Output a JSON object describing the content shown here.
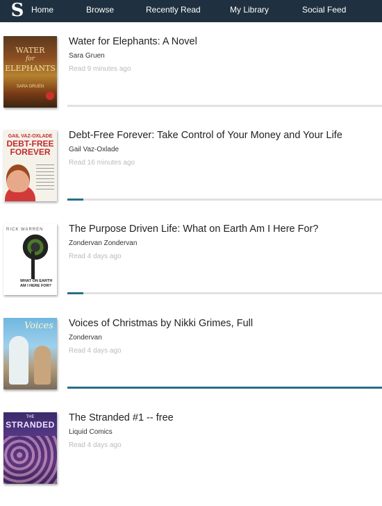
{
  "nav": {
    "logo": "S",
    "items": [
      "Home",
      "Browse",
      "Recently Read",
      "My Library",
      "Social Feed"
    ]
  },
  "books": [
    {
      "title": "Water for Elephants: A Novel",
      "author": "Sara Gruen",
      "read": "Read 9 minutes ago",
      "progress": 0,
      "cover_text": [
        "WATER",
        "for",
        "ELEPHANTS",
        "SARA GRUEN"
      ]
    },
    {
      "title": "Debt-Free Forever: Take Control of Your Money and Your Life",
      "author": "Gail Vaz-Oxlade",
      "read": "Read 16 minutes ago",
      "progress": 0.05,
      "cover_text": [
        "GAIL VAZ-OXLADE",
        "DEBT-FREE",
        "FOREVER"
      ]
    },
    {
      "title": "The Purpose Driven Life: What on Earth Am I Here For?",
      "author": "Zondervan Zondervan",
      "read": "Read 4 days ago",
      "progress": 0.05,
      "cover_text": [
        "RICK WARREN",
        "WHAT ON EARTH",
        "AM I HERE FOR?"
      ]
    },
    {
      "title": "Voices of Christmas by Nikki Grimes, Full",
      "author": "Zondervan",
      "read": "Read 4 days ago",
      "progress": 1,
      "cover_text": [
        "Voices"
      ]
    },
    {
      "title": "The Stranded #1 -- free",
      "author": "Liquid Comics",
      "read": "Read 4 days ago",
      "progress": 0,
      "cover_text": [
        "THE",
        "STRANDED"
      ]
    }
  ],
  "colors": {
    "nav_bg": "#1f3140",
    "progress_fill": "#276f85",
    "progress_track": "#e1e1e1"
  }
}
